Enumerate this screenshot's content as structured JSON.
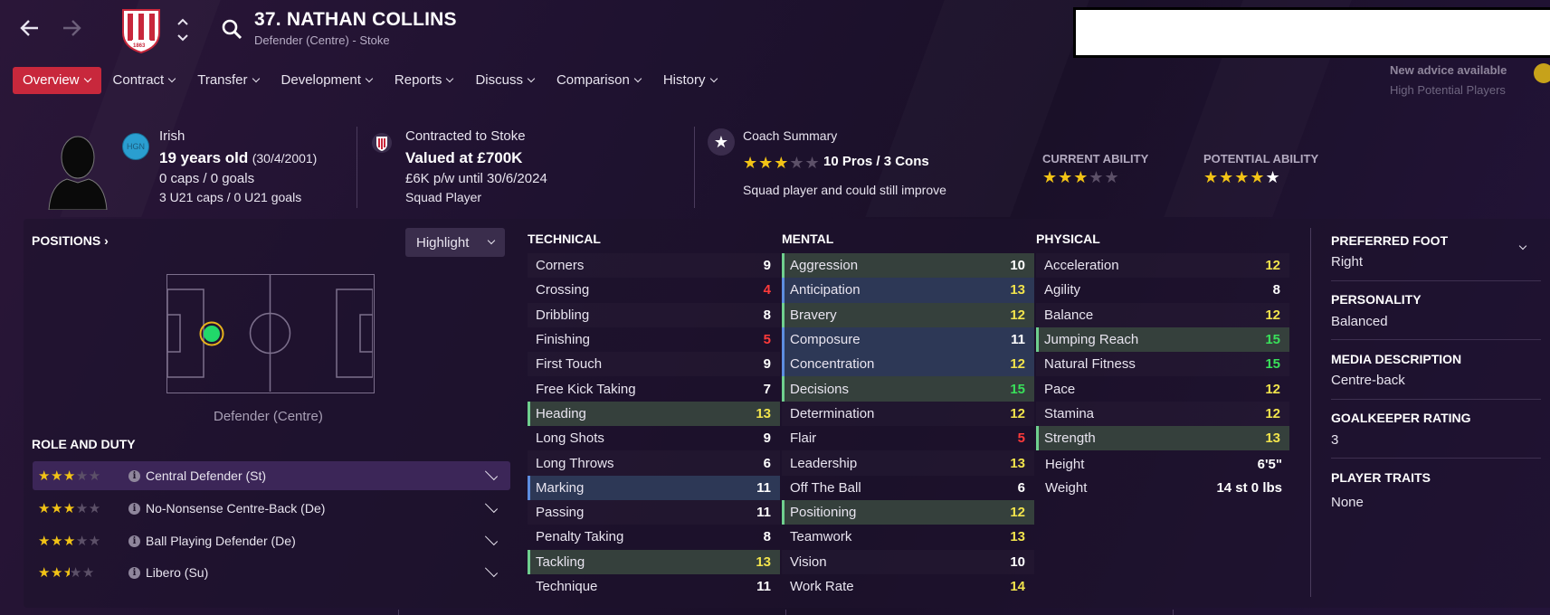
{
  "header": {
    "player_name": "37. NATHAN COLLINS",
    "player_subtitle": "Defender (Centre) - Stoke",
    "club_year": "1863",
    "advice_title": "New advice available",
    "advice_sub": "High Potential Players"
  },
  "tabs": [
    {
      "label": "Overview"
    },
    {
      "label": "Contract"
    },
    {
      "label": "Transfer"
    },
    {
      "label": "Development"
    },
    {
      "label": "Reports"
    },
    {
      "label": "Discuss"
    },
    {
      "label": "Comparison"
    },
    {
      "label": "History"
    }
  ],
  "info": {
    "nation_code": "HGN",
    "nationality": "Irish",
    "age": "19 years old",
    "dob": "(30/4/2001)",
    "caps": "0 caps / 0 goals",
    "u21_caps": "3 U21 caps / 0 U21 goals",
    "contract": "Contracted to Stoke",
    "value": "Valued at £700K",
    "wage": "£6K p/w until 30/6/2024",
    "squad_status": "Squad Player",
    "coach_summary_title": "Coach Summary",
    "coach_stars": 3,
    "pros_cons": "10 Pros / 3 Cons",
    "coach_comment": "Squad player and could still improve",
    "current_ability_label": "CURRENT ABILITY",
    "current_ability_stars": 3,
    "potential_ability_label": "POTENTIAL ABILITY",
    "potential_ability_stars": 5
  },
  "positions": {
    "title": "POSITIONS",
    "highlight_label": "Highlight",
    "position_label": "Defender (Centre)",
    "role_title": "ROLE AND DUTY",
    "roles": [
      {
        "name": "Central Defender (St)",
        "stars": 3
      },
      {
        "name": "No-Nonsense Centre-Back (De)",
        "stars": 3
      },
      {
        "name": "Ball Playing Defender (De)",
        "stars": 3
      },
      {
        "name": "Libero (Su)",
        "stars": 2.5
      }
    ]
  },
  "technical": {
    "title": "TECHNICAL",
    "attrs": [
      {
        "name": "Corners",
        "value": "9"
      },
      {
        "name": "Crossing",
        "value": "4"
      },
      {
        "name": "Dribbling",
        "value": "8"
      },
      {
        "name": "Finishing",
        "value": "5"
      },
      {
        "name": "First Touch",
        "value": "9"
      },
      {
        "name": "Free Kick Taking",
        "value": "7"
      },
      {
        "name": "Heading",
        "value": "13"
      },
      {
        "name": "Long Shots",
        "value": "9"
      },
      {
        "name": "Long Throws",
        "value": "6"
      },
      {
        "name": "Marking",
        "value": "11"
      },
      {
        "name": "Passing",
        "value": "11"
      },
      {
        "name": "Penalty Taking",
        "value": "8"
      },
      {
        "name": "Tackling",
        "value": "13"
      },
      {
        "name": "Technique",
        "value": "11"
      }
    ]
  },
  "mental": {
    "title": "MENTAL",
    "attrs": [
      {
        "name": "Aggression",
        "value": "10"
      },
      {
        "name": "Anticipation",
        "value": "13"
      },
      {
        "name": "Bravery",
        "value": "12"
      },
      {
        "name": "Composure",
        "value": "11"
      },
      {
        "name": "Concentration",
        "value": "12"
      },
      {
        "name": "Decisions",
        "value": "15"
      },
      {
        "name": "Determination",
        "value": "12"
      },
      {
        "name": "Flair",
        "value": "5"
      },
      {
        "name": "Leadership",
        "value": "13"
      },
      {
        "name": "Off The Ball",
        "value": "6"
      },
      {
        "name": "Positioning",
        "value": "12"
      },
      {
        "name": "Teamwork",
        "value": "13"
      },
      {
        "name": "Vision",
        "value": "10"
      },
      {
        "name": "Work Rate",
        "value": "14"
      }
    ]
  },
  "physical": {
    "title": "PHYSICAL",
    "attrs": [
      {
        "name": "Acceleration",
        "value": "12"
      },
      {
        "name": "Agility",
        "value": "8"
      },
      {
        "name": "Balance",
        "value": "12"
      },
      {
        "name": "Jumping Reach",
        "value": "15"
      },
      {
        "name": "Natural Fitness",
        "value": "15"
      },
      {
        "name": "Pace",
        "value": "12"
      },
      {
        "name": "Stamina",
        "value": "12"
      },
      {
        "name": "Strength",
        "value": "13"
      }
    ],
    "height_label": "Height",
    "height": "6'5\"",
    "weight_label": "Weight",
    "weight": "14 st 0 lbs"
  },
  "side": {
    "foot_title": "PREFERRED FOOT",
    "foot": "Right",
    "personality_title": "PERSONALITY",
    "personality": "Balanced",
    "media_title": "MEDIA DESCRIPTION",
    "media": "Centre-back",
    "gk_title": "GOALKEEPER RATING",
    "gk": "3",
    "traits_title": "PLAYER TRAITS",
    "traits": "None"
  },
  "colors": {
    "accent": "#c8283c",
    "highlight_green": "#6fcf8e",
    "highlight_blue": "#5d8de0",
    "star": "#f2c316"
  },
  "icons": [
    "back-arrow-icon",
    "forward-arrow-icon",
    "club-crest-icon",
    "search-icon",
    "chevron-down-icon",
    "star-icon",
    "info-icon"
  ]
}
